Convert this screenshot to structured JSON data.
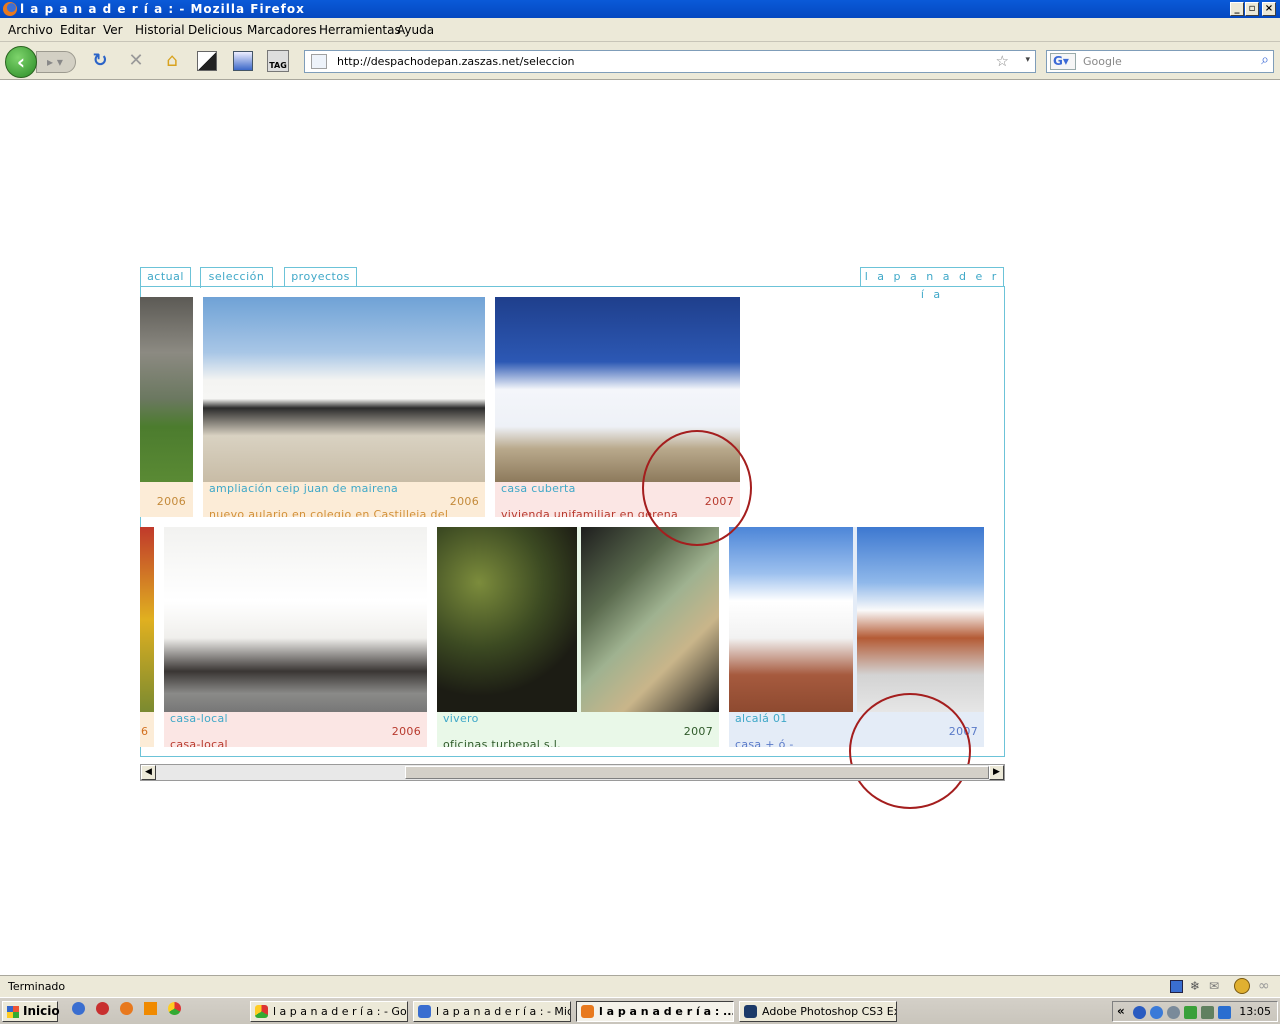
{
  "window": {
    "title": "l a p a n a d e r í a : - Mozilla Firefox"
  },
  "menu": [
    "Archivo",
    "Editar",
    "Ver",
    "Historial",
    "Delicious",
    "Marcadores",
    "Herramientas",
    "Ayuda"
  ],
  "navbar": {
    "url": "http://despachodepan.zaszas.net/seleccion",
    "search_placeholder": "Google"
  },
  "site": {
    "tabs": {
      "actual": "actual",
      "seleccion": "selección",
      "proyectos": "proyectos",
      "brand": "l a p a n a d e r í a"
    },
    "row1": [
      {
        "year": "2006"
      },
      {
        "title": "ampliación ceip juan de mairena",
        "year": "2006",
        "subtitle": "nuevo aulario en colegio en Castilleja del"
      },
      {
        "title": "casa cuberta",
        "year": "2007",
        "subtitle": "vivienda unifamiliar en gerena"
      }
    ],
    "row2": [
      {
        "year": "6"
      },
      {
        "title": "casa-local",
        "year": "2006",
        "subtitle": "casa-local"
      },
      {
        "title": "vivero",
        "year": "2007",
        "subtitle": "oficinas turbepal s.l."
      },
      {
        "title": "alcalá 01",
        "year": "2007",
        "subtitle": "casa + ó -"
      }
    ],
    "colors": {
      "accent": "#3fa8c8",
      "frame": "#6cc3d8",
      "highlight_circle": "#a41e1e"
    }
  },
  "statusbar": {
    "text": "Terminado"
  },
  "taskbar": {
    "start": "Inicio",
    "tasks": [
      "l a p a n a d e r í a : - Goo...",
      "l a p a n a d e r í a : - Micr...",
      "l a p a n a d e r í a : ...",
      "Adobe Photoshop CS3 Ex..."
    ],
    "clock": "13:05"
  }
}
